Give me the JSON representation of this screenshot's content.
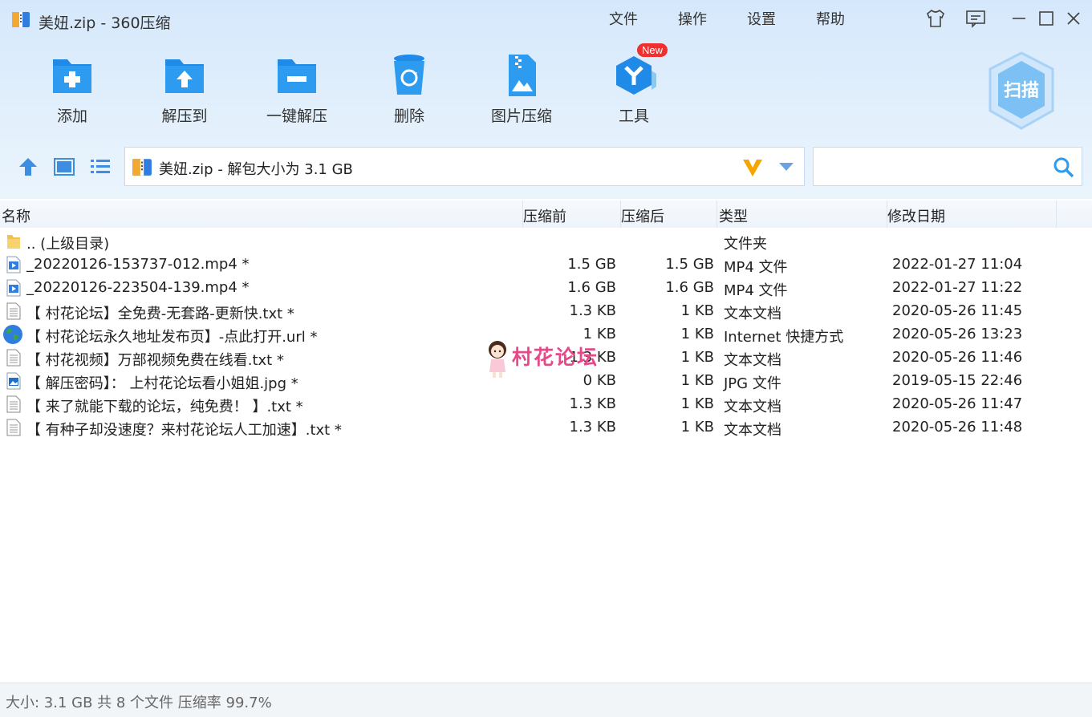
{
  "window": {
    "title": "美妞.zip - 360压缩",
    "menu": [
      "文件",
      "操作",
      "设置",
      "帮助"
    ]
  },
  "toolbar": {
    "items": [
      {
        "label": "添加",
        "icon": "add-folder-icon"
      },
      {
        "label": "解压到",
        "icon": "extract-to-icon"
      },
      {
        "label": "一键解压",
        "icon": "one-click-extract-icon"
      },
      {
        "label": "删除",
        "icon": "delete-icon"
      },
      {
        "label": "图片压缩",
        "icon": "image-compress-icon"
      },
      {
        "label": "工具",
        "icon": "tools-icon"
      }
    ],
    "new_badge": "New",
    "scan_label": "扫描"
  },
  "address": {
    "text": "美妞.zip - 解包大小为 3.1 GB",
    "search_placeholder": ""
  },
  "columns": [
    "名称",
    "压缩前",
    "压缩后",
    "类型",
    "修改日期"
  ],
  "files": [
    {
      "name": ".. (上级目录)",
      "before": "",
      "after": "",
      "type": "文件夹",
      "date": "",
      "icon": "folder-icon"
    },
    {
      "name": "_20220126-153737-012.mp4 *",
      "before": "1.5 GB",
      "after": "1.5 GB",
      "type": "MP4 文件",
      "date": "2022-01-27 11:04",
      "icon": "video-file-icon"
    },
    {
      "name": "_20220126-223504-139.mp4 *",
      "before": "1.6 GB",
      "after": "1.6 GB",
      "type": "MP4 文件",
      "date": "2022-01-27 11:22",
      "icon": "video-file-icon"
    },
    {
      "name": "【 村花论坛】全免费-无套路-更新快.txt *",
      "before": "1.3 KB",
      "after": "1 KB",
      "type": "文本文档",
      "date": "2020-05-26 11:45",
      "icon": "text-file-icon"
    },
    {
      "name": "【 村花论坛永久地址发布页】-点此打开.url *",
      "before": "1 KB",
      "after": "1 KB",
      "type": "Internet 快捷方式",
      "date": "2020-05-26 13:23",
      "icon": "globe-icon"
    },
    {
      "name": "【 村花视频】万部视频免费在线看.txt *",
      "before": "1.3 KB",
      "after": "1 KB",
      "type": "文本文档",
      "date": "2020-05-26 11:46",
      "icon": "text-file-icon"
    },
    {
      "name": "【 解压密码】： 上村花论坛看小姐姐.jpg *",
      "before": "0 KB",
      "after": "1 KB",
      "type": "JPG 文件",
      "date": "2019-05-15 22:46",
      "icon": "image-file-icon"
    },
    {
      "name": "【 来了就能下载的论坛，纯免费！ 】.txt *",
      "before": "1.3 KB",
      "after": "1 KB",
      "type": "文本文档",
      "date": "2020-05-26 11:47",
      "icon": "text-file-icon"
    },
    {
      "name": "【 有种子却没速度？来村花论坛人工加速】.txt *",
      "before": "1.3 KB",
      "after": "1 KB",
      "type": "文本文档",
      "date": "2020-05-26 11:48",
      "icon": "text-file-icon"
    }
  ],
  "watermark_text": "村花论坛",
  "status": "大小: 3.1 GB 共 8 个文件 压缩率 99.7%",
  "colors": {
    "accent": "#1e88e5",
    "badge": "#f0302f",
    "watermark": "#e8478a"
  }
}
